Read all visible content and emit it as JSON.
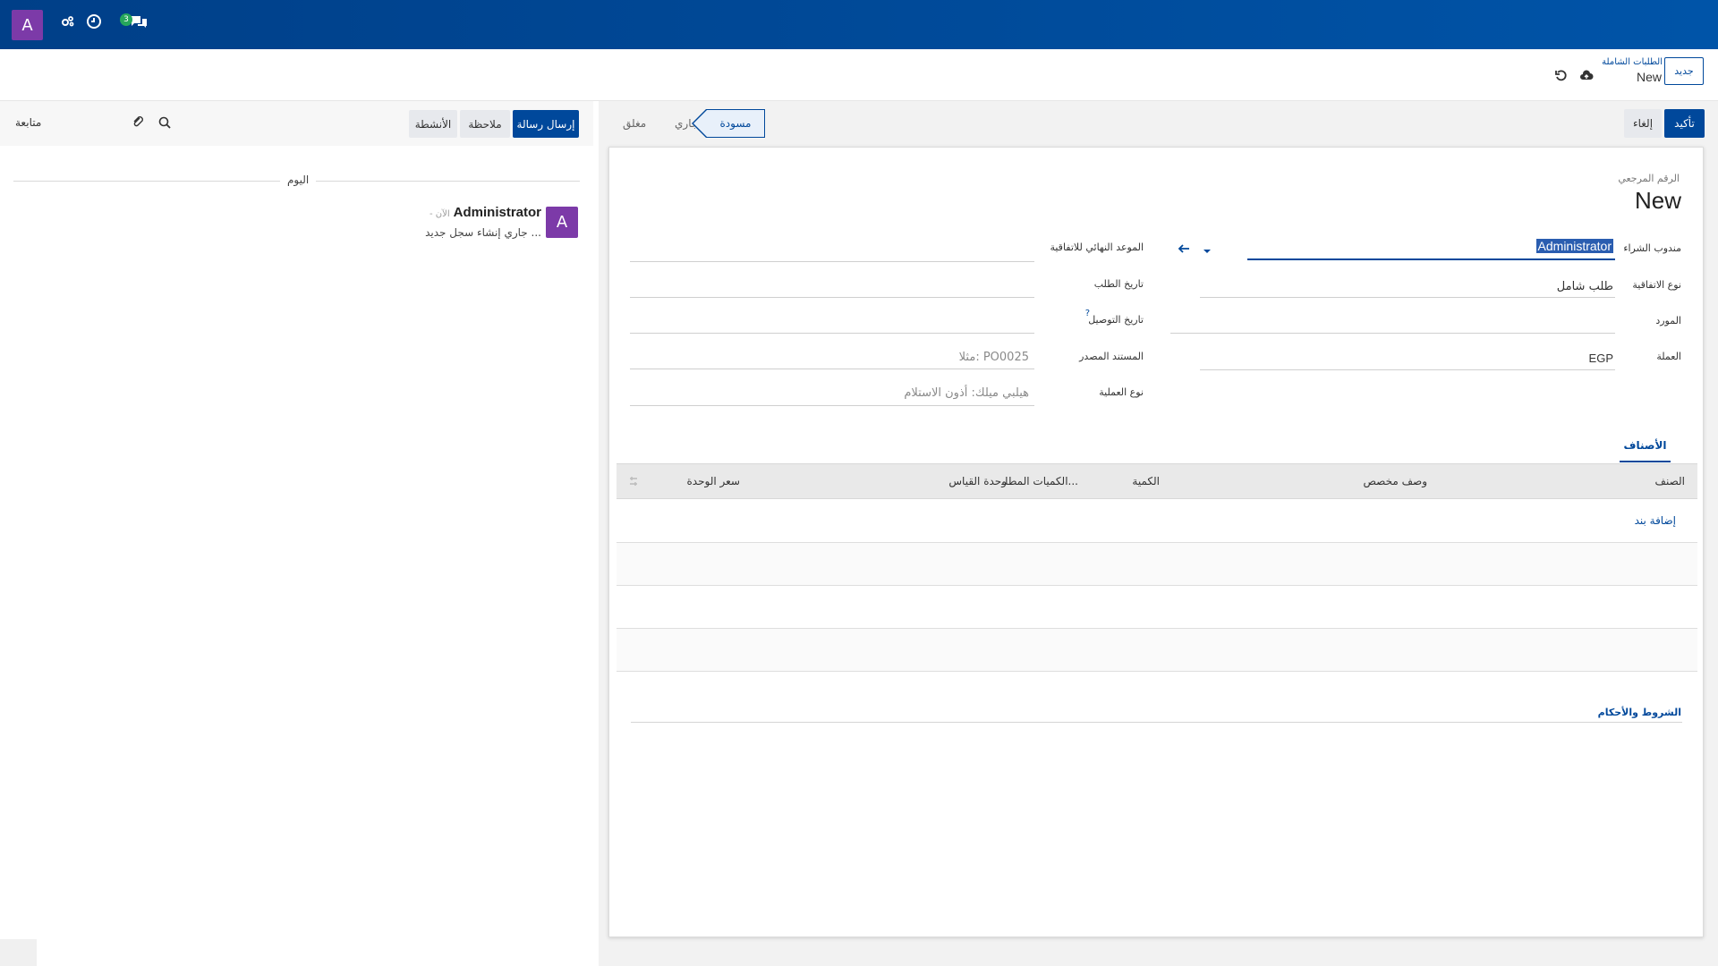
{
  "navbar": {
    "avatar_letter": "A",
    "badge_count": "3"
  },
  "control": {
    "new_button": "جديد",
    "breadcrumb_parent": "الطلبات الشاملة",
    "breadcrumb_current": "New"
  },
  "actions": {
    "confirm": "تأكيد",
    "cancel": "إلغاء"
  },
  "statusbar": {
    "closed": "مغلق",
    "ongoing": "جاري",
    "draft": "مسودة"
  },
  "form": {
    "reference_label": "الرقم المرجعي",
    "reference_value": "New",
    "purchase_rep_label": "مندوب الشراء",
    "purchase_rep_value": "Administrator",
    "agreement_type_label": "نوع الاتفاقية",
    "agreement_type_value": "طلب شامل",
    "vendor_label": "المورد",
    "currency_label": "العملة",
    "currency_value": "EGP",
    "deadline_label": "الموعد النهائي للاتفاقية",
    "order_date_label": "تاريخ الطلب",
    "delivery_date_label": "تاريخ التوصيل",
    "delivery_help": "?",
    "source_doc_label": "المستند المصدر",
    "source_doc_placeholder": "مثلا: PO0025",
    "operation_type_label": "نوع العملية",
    "operation_type_placeholder": "هيلبي ميلك: أذون الاستلام"
  },
  "tabs": {
    "products": "الأصناف"
  },
  "table": {
    "headers": {
      "product": "الصنف",
      "custom_description": "وصف مخصص",
      "quantity": "الكمية",
      "ordered_quantities": "الكميات المطلـ...",
      "uom": "وحدة القياس",
      "unit_price": "سعر الوحدة"
    },
    "add_line": "إضافة بند"
  },
  "terms": "الشروط والأحكام",
  "chatter": {
    "send_message": "إرسال رسالة",
    "log_note": "ملاحظة",
    "activities": "الأنشطة",
    "follow": "متابعة",
    "today": "اليوم",
    "message": {
      "avatar_letter": "A",
      "author": "Administrator",
      "time": "- الآن",
      "body": "جاري إنشاء سجل جديد ..."
    }
  },
  "colors": {
    "brand": "#00489b",
    "avatar": "#7c3aa8",
    "badge": "#26a65b"
  }
}
